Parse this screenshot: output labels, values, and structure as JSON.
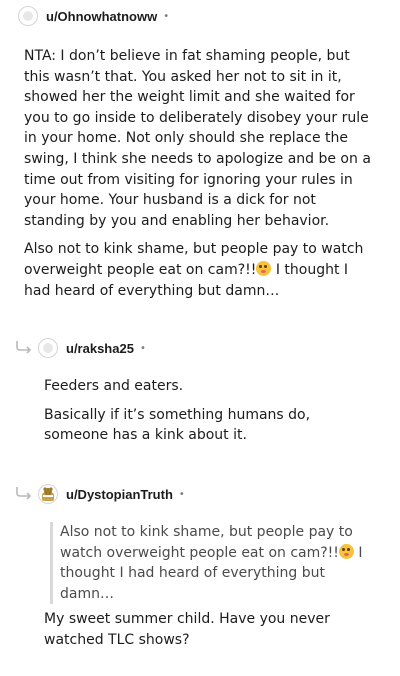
{
  "comments": [
    {
      "username": "u/Ohnowhatnoww",
      "paragraphs": [
        "NTA: I don’t believe in fat shaming people, but this wasn’t that. You asked her not to sit in it, showed her the weight limit and she waited for you to go inside to deliberately disobey your rule in your home. Not only should she replace the swing, I think she needs to apologize and be on a time out from visiting for ignoring your rules in your home. Your husband is a dick for not standing by you and enabling her behavior."
      ],
      "para2_before": "Also not to kink shame, but people pay to watch overweight people eat on cam?!!",
      "para2_after": " I thought I had heard of everything but damn…"
    },
    {
      "username": "u/raksha25",
      "paragraphs": [
        "Feeders and eaters.",
        "Basically if it’s something humans do, someone has a kink about it."
      ]
    },
    {
      "username": "u/DystopianTruth",
      "quote_before": "Also not to kink shame, but people pay to watch overweight people eat on cam?!!",
      "quote_after": " I thought I had heard of everything but damn…",
      "paragraphs": [
        "My sweet summer child. Have you never watched TLC shows?"
      ]
    }
  ],
  "separator": "•",
  "colors": {
    "text": "#1c1c1c",
    "meta": "#7c7c7c",
    "quote_bar": "#d9d9d9"
  },
  "icons": {
    "emoji": "flushed-face-emoji",
    "reply": "reply-arrow-icon"
  }
}
